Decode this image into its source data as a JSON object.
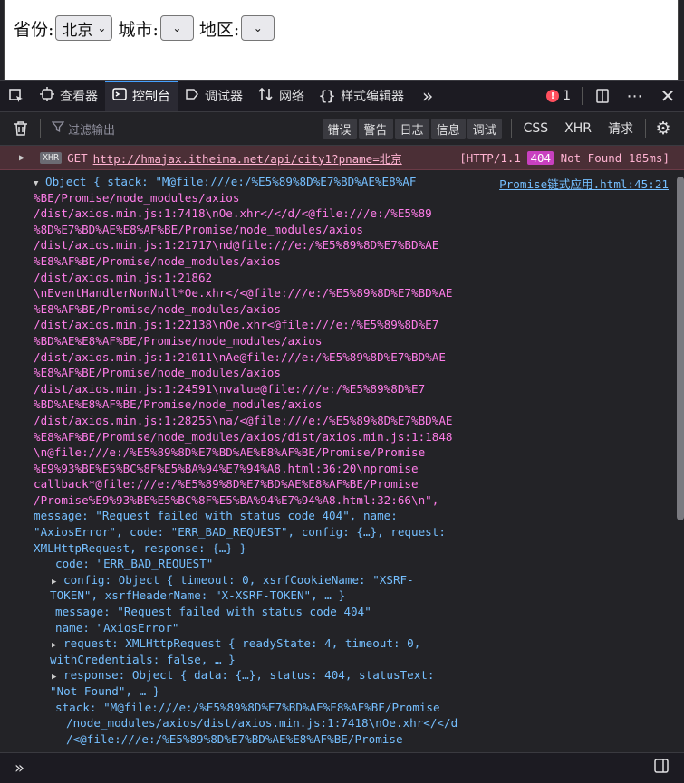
{
  "page": {
    "province_label": "省份:",
    "province_value": "北京",
    "city_label": "城市:",
    "area_label": "地区:"
  },
  "devtools": {
    "tabs": [
      {
        "label": "查看器",
        "icon": "inspector-icon"
      },
      {
        "label": "控制台",
        "icon": "console-icon"
      },
      {
        "label": "调试器",
        "icon": "debugger-icon"
      },
      {
        "label": "网络",
        "icon": "network-icon"
      },
      {
        "label": "样式编辑器",
        "icon": "style-editor-icon"
      }
    ],
    "error_count": "1",
    "filter_placeholder": "过滤输出",
    "levels": [
      "错误",
      "警告",
      "日志",
      "信息",
      "调试"
    ],
    "types": [
      "CSS",
      "XHR",
      "请求"
    ]
  },
  "console": {
    "request": {
      "tag": "XHR",
      "method": "GET",
      "url": "http://hmajax.itheima.net/api/city1?pname=北京",
      "status_prefix": "[HTTP/1.1",
      "status_code": "404",
      "status_suffix": "Not Found 185ms]"
    },
    "source_link": "Promise链式应用.html:45:21",
    "stack_lines": [
      "Object { stack: \"M@file:///e:/%E5%89%8D%E7%BD%AE%E8%AF",
      "%BE/Promise/node_modules/axios",
      "/dist/axios.min.js:1:7418\\nOe.xhr</</d/<@file:///e:/%E5%89",
      "%8D%E7%BD%AE%E8%AF%BE/Promise/node_modules/axios",
      "/dist/axios.min.js:1:21717\\nd@file:///e:/%E5%89%8D%E7%BD%AE",
      "%E8%AF%BE/Promise/node_modules/axios",
      "/dist/axios.min.js:1:21862",
      "\\nEventHandlerNonNull*Oe.xhr</<@file:///e:/%E5%89%8D%E7%BD%AE",
      "%E8%AF%BE/Promise/node_modules/axios",
      "/dist/axios.min.js:1:22138\\nOe.xhr<@file:///e:/%E5%89%8D%E7",
      "%BD%AE%E8%AF%BE/Promise/node_modules/axios",
      "/dist/axios.min.js:1:21011\\nAe@file:///e:/%E5%89%8D%E7%BD%AE",
      "%E8%AF%BE/Promise/node_modules/axios",
      "/dist/axios.min.js:1:24591\\nvalue@file:///e:/%E5%89%8D%E7",
      "%BD%AE%E8%AF%BE/Promise/node_modules/axios",
      "/dist/axios.min.js:1:28255\\na/<@file:///e:/%E5%89%8D%E7%BD%AE",
      "%E8%AF%BE/Promise/node_modules/axios/dist/axios.min.js:1:1848",
      "\\n@file:///e:/%E5%89%8D%E7%BD%AE%E8%AF%BE/Promise/Promise",
      "%E9%93%BE%E5%BC%8F%E5%BA%94%E7%94%A8.html:36:20\\npromise",
      "callback*@file:///e:/%E5%89%8D%E7%BD%AE%E8%AF%BE/Promise",
      "/Promise%E9%93%BE%E5%BC%8F%E5%BA%94%E7%94%A8.html:32:66\\n\","
    ],
    "summary_lines": [
      "message: \"Request failed with status code 404\", name:",
      "\"AxiosError\", code: \"ERR_BAD_REQUEST\", config: {…}, request:",
      "XMLHttpRequest, response: {…} }"
    ],
    "props": [
      {
        "indent": 2,
        "expander": false,
        "text": "code: \"ERR_BAD_REQUEST\""
      },
      {
        "indent": 2,
        "expander": true,
        "text": "config: Object { timeout: 0, xsrfCookieName: \"XSRF-"
      },
      {
        "indent": 1,
        "expander": false,
        "text": "TOKEN\", xsrfHeaderName: \"X-XSRF-TOKEN\", … }"
      },
      {
        "indent": 2,
        "expander": false,
        "text": "message: \"Request failed with status code 404\""
      },
      {
        "indent": 2,
        "expander": false,
        "text": "name: \"AxiosError\""
      },
      {
        "indent": 2,
        "expander": true,
        "text": "request: XMLHttpRequest { readyState: 4, timeout: 0,"
      },
      {
        "indent": 1,
        "expander": false,
        "text": "withCredentials: false, … }"
      },
      {
        "indent": 2,
        "expander": true,
        "text": "response: Object { data: {…}, status: 404, statusText:"
      },
      {
        "indent": 1,
        "expander": false,
        "text": "\"Not Found\", … }"
      },
      {
        "indent": 2,
        "expander": false,
        "text": "stack: \"M@file:///e:/%E5%89%8D%E7%BD%AE%E8%AF%BE/Promise"
      },
      {
        "indent": 3,
        "expander": false,
        "text": "/node_modules/axios/dist/axios.min.js:1:7418\\nOe.xhr</</d"
      },
      {
        "indent": 3,
        "expander": false,
        "text": "/<@file:///e:/%E5%89%8D%E7%BD%AE%E8%AF%BE/Promise"
      }
    ]
  }
}
